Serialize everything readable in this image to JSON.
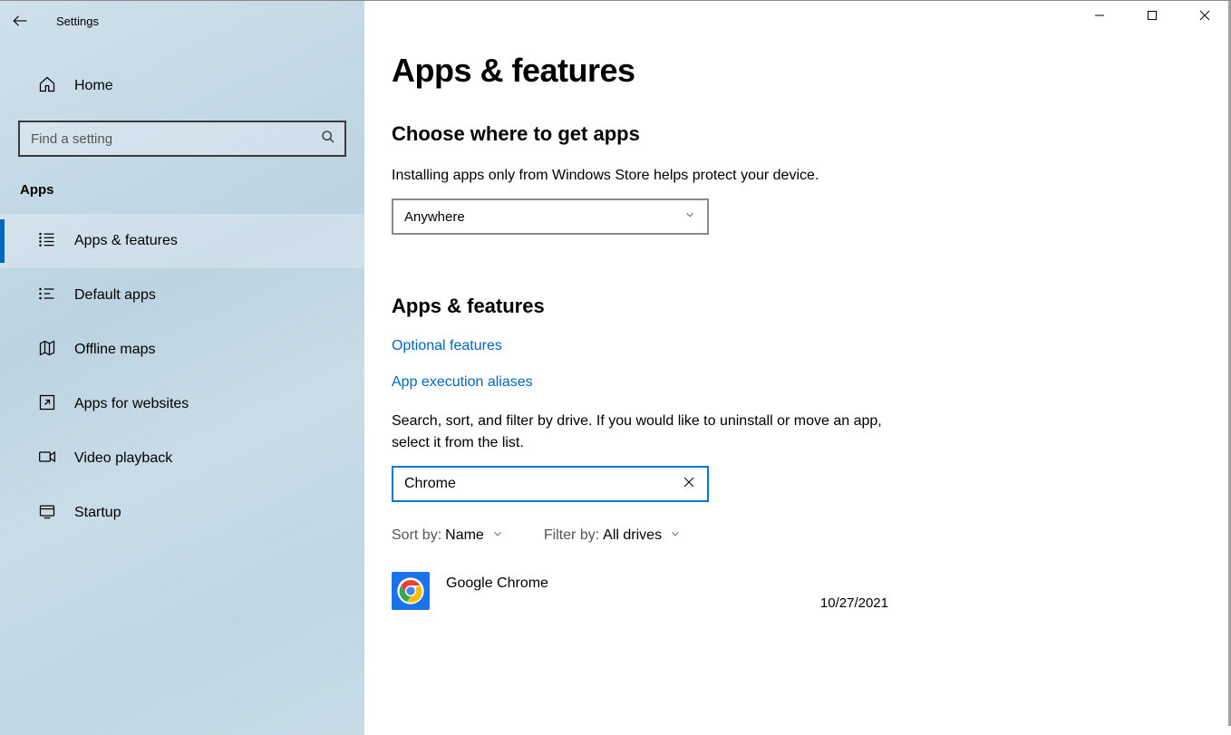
{
  "appTitle": "Settings",
  "homeLabel": "Home",
  "searchPlaceholder": "Find a setting",
  "sidebarSection": "Apps",
  "nav": {
    "appsfeatures": "Apps & features",
    "defaultapps": "Default apps",
    "offlinemaps": "Offline maps",
    "appsforwebsites": "Apps for websites",
    "videoplayback": "Video playback",
    "startup": "Startup"
  },
  "pageTitle": "Apps & features",
  "chooseHead": "Choose where to get apps",
  "chooseDesc": "Installing apps only from Windows Store helps protect your device.",
  "sourceSelected": "Anywhere",
  "featuresHead": "Apps & features",
  "linkOptional": "Optional features",
  "linkAliases": "App execution aliases",
  "listDesc": "Search, sort, and filter by drive. If you would like to uninstall or move an app, select it from the list.",
  "appSearchValue": "Chrome",
  "sortByLabel": "Sort by:",
  "sortByValue": "Name",
  "filterByLabel": "Filter by:",
  "filterByValue": "All drives",
  "apps": [
    {
      "name": "Google Chrome",
      "date": "10/27/2021"
    }
  ]
}
